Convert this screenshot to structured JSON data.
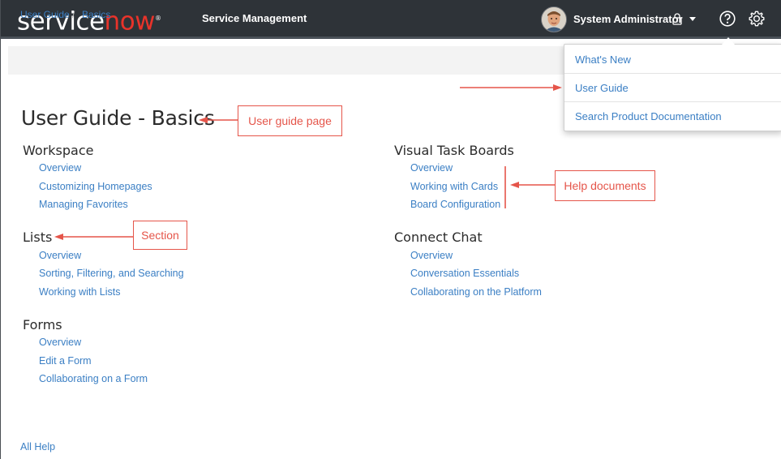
{
  "header": {
    "logo_part1": "service",
    "logo_part2": "now",
    "logo_tm": "®",
    "product_name": "Service Management",
    "user_name": "System Administrator",
    "bar_color": "#2e3338",
    "icons": [
      "avatar",
      "lock-icon",
      "chevron-down-icon",
      "help-icon",
      "gear-icon"
    ]
  },
  "breadcrumb": {
    "items": [
      "User Guide",
      "Basics"
    ],
    "separator": "/"
  },
  "help_menu": {
    "items": [
      "What's New",
      "User Guide",
      "Search Product Documentation"
    ]
  },
  "page": {
    "title": "User Guide - Basics",
    "left_sections": [
      {
        "title": "Workspace",
        "links": [
          "Overview",
          "Customizing Homepages",
          "Managing Favorites"
        ]
      },
      {
        "title": "Lists",
        "links": [
          "Overview",
          "Sorting, Filtering, and Searching",
          "Working with Lists"
        ]
      },
      {
        "title": "Forms",
        "links": [
          "Overview",
          "Edit a Form",
          "Collaborating on a Form"
        ]
      }
    ],
    "right_sections": [
      {
        "title": "Visual Task Boards",
        "links": [
          "Overview",
          "Working with Cards",
          "Board Configuration"
        ]
      },
      {
        "title": "Connect Chat",
        "links": [
          "Overview",
          "Conversation Essentials",
          "Collaborating on the Platform"
        ]
      }
    ],
    "footer_link": "All Help",
    "link_color": "#3b7fc4"
  },
  "annotations": {
    "user_guide_page": "User guide page",
    "section": "Section",
    "help_documents": "Help documents",
    "color": "#e5554a"
  }
}
